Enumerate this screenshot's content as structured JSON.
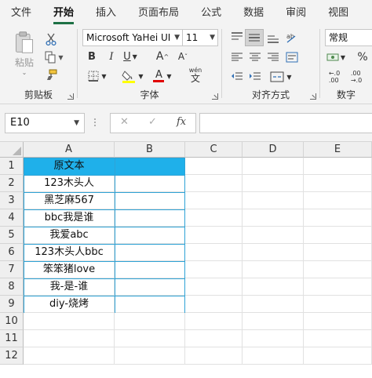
{
  "menu": {
    "tabs": [
      {
        "label": "文件",
        "active": false
      },
      {
        "label": "开始",
        "active": true
      },
      {
        "label": "插入",
        "active": false
      },
      {
        "label": "页面布局",
        "active": false
      },
      {
        "label": "公式",
        "active": false
      },
      {
        "label": "数据",
        "active": false
      },
      {
        "label": "审阅",
        "active": false
      },
      {
        "label": "视图",
        "active": false
      }
    ]
  },
  "ribbon": {
    "clipboard": {
      "label": "剪贴板",
      "paste_label": "粘贴"
    },
    "font": {
      "label": "字体",
      "font_name": "Microsoft YaHei UI",
      "font_size": "11",
      "bold": "B",
      "italic": "I",
      "underline": "U",
      "grow": "A",
      "shrink": "A",
      "wen": "wén",
      "highlight_color": "#ffff00",
      "font_color": "#e00000"
    },
    "alignment": {
      "label": "对齐方式"
    },
    "number": {
      "label": "数字",
      "format": "常规"
    }
  },
  "formula_bar": {
    "name_box": "E10",
    "cancel": "✕",
    "enter": "✓",
    "fx": "fx",
    "value": ""
  },
  "sheet": {
    "columns": [
      "A",
      "B",
      "C",
      "D",
      "E"
    ],
    "rows": [
      "1",
      "2",
      "3",
      "4",
      "5",
      "6",
      "7",
      "8",
      "9",
      "10",
      "11",
      "12"
    ],
    "header_color": "#1fb0ea",
    "cells_A": [
      "原文本",
      "123木头人",
      "黑芝麻567",
      "bbc我是谁",
      "我爱abc",
      "123木头人bbc",
      "笨笨猪love",
      "我-是-谁",
      "diy-烧烤"
    ]
  }
}
